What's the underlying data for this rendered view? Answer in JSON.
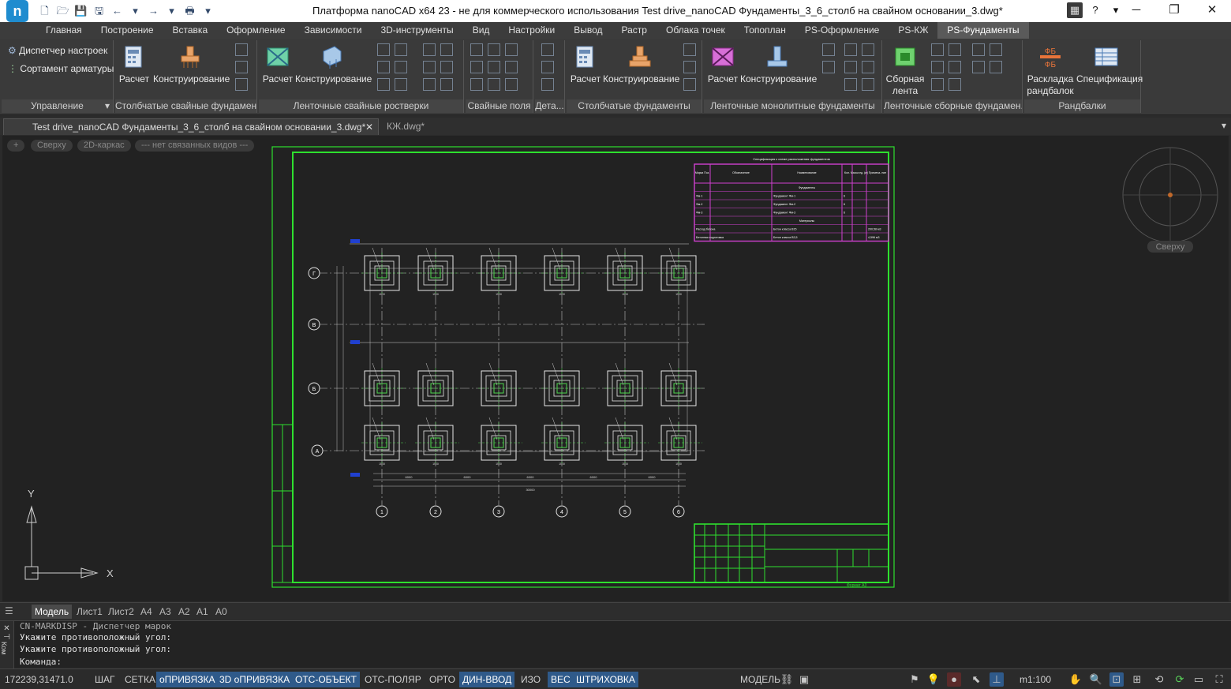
{
  "window": {
    "title": "Платформа nanoCAD x64 23 - не для коммерческого использования Test drive_nanoCAD Фундаменты_3_6_столб на свайном основании_3.dwg*",
    "min": "─",
    "max": "❐",
    "close": "✕",
    "help": "?",
    "help_arrow": "▾"
  },
  "qat": [
    "🗋",
    "🗁",
    "💾",
    "🖫",
    "←",
    "▾",
    "→",
    "▾",
    "🖶",
    "▾"
  ],
  "menu": [
    "Главная",
    "Построение",
    "Вставка",
    "Оформление",
    "Зависимости",
    "3D-инструменты",
    "Вид",
    "Настройки",
    "Вывод",
    "Растр",
    "Облака точек",
    "Топоплан",
    "PS-Оформление",
    "PS-КЖ",
    "PS-Фундаменты"
  ],
  "ribbon": {
    "manage": {
      "item1": "Диспетчер настроек",
      "item2": "Сортамент арматуры",
      "label": "Управление",
      "arrow": "▾"
    },
    "p1": {
      "b1": "Расчет",
      "b2": "Конструирование",
      "label": "Столбчатые свайные фундамент..."
    },
    "p2": {
      "b1": "Расчет",
      "b2": "Конструирование",
      "label": "Ленточные свайные ростверки"
    },
    "p3": {
      "label": "Свайные поля"
    },
    "p4": {
      "label": "Дета..."
    },
    "p5": {
      "b1": "Расчет",
      "b2": "Конструирование",
      "label": "Столбчатые фундаменты"
    },
    "p6": {
      "b1": "Расчет",
      "b2": "Конструирование",
      "label": "Ленточные монолитные фундаменты"
    },
    "p7": {
      "b1": "Сборная лента",
      "label": "Ленточные сборные фундамен..."
    },
    "p8": {
      "b1": "Раскладка рандбалок",
      "b2": "Спецификация",
      "label": "Рандбалки",
      "icon1": "ФБ"
    }
  },
  "doctabs": {
    "tab1": "Test drive_nanoCAD Фундаменты_3_6_столб на свайном основании_3.dwg*",
    "tab1_close": "✕",
    "tab2": "КЖ.dwg*",
    "menu": "▾"
  },
  "viewport": {
    "pill_plus": "+",
    "pill_view": "Сверху",
    "pill_style": "2D-каркас",
    "pill_named": "--- нет связанных видов ---",
    "viewcube_label": "Сверху",
    "ucs_x": "X",
    "ucs_y": "Y",
    "drawing": {
      "spec_title": "Спецификация к схеме расположения фундаментов",
      "spec_headers": [
        "Марка Поз.",
        "Обозначение",
        "Наименование",
        "Кол.",
        "Масса ед. (кг)",
        "Примеча- ние"
      ],
      "spec_rows": [
        [
          "",
          "",
          "Фундаменты",
          "",
          "",
          ""
        ],
        [
          "Фм-1",
          "",
          "Фундамент Фм-1",
          "6",
          "",
          ""
        ],
        [
          "Фм-2",
          "",
          "Фундамент Фм-2",
          "6",
          "",
          ""
        ],
        [
          "Фм-3",
          "",
          "Фундамент Фм-3",
          "6",
          "",
          ""
        ],
        [
          "",
          "",
          "Материалы",
          "",
          "",
          ""
        ],
        [
          "Расход бетона",
          "",
          "Бетон класса В15",
          "",
          "",
          "200,58 м3"
        ],
        [
          "Бетонная подготовка",
          "",
          "Бетон класса В3,5",
          "",
          "",
          "4,596 м3"
        ]
      ],
      "axes_rows": [
        "Г",
        "В",
        "Б",
        "А"
      ],
      "axes_cols": [
        "1",
        "2",
        "3",
        "4",
        "5",
        "6"
      ],
      "dims_col": [
        "6000",
        "6000",
        "6000",
        "6000",
        "6000"
      ],
      "dim_total": "30000",
      "dim_cell": "1500",
      "stamp_small": "Формат А3"
    }
  },
  "layouts": [
    "Модель",
    "Лист1",
    "Лист2",
    "А4",
    "А3",
    "А2",
    "А1",
    "А0"
  ],
  "command": {
    "lines": [
      "CN-MARKDISP - Диспетчер марок",
      "Укажите противоположный угол:",
      "Укажите противоположный угол:",
      "Команда:"
    ],
    "side_close": "✕",
    "side_pin": "⊣",
    "side_label": "Ком"
  },
  "status": {
    "coords": "172239,31471.0",
    "toggles": [
      "ШАГ",
      "СЕТКА",
      "оПРИВЯЗКА",
      "3D оПРИВЯЗКА",
      "ОТС-ОБЪЕКТ",
      "ОТС-ПОЛЯР",
      "ОРТО",
      "ДИН-ВВОД",
      "ИЗО",
      "ВЕС",
      "ШТРИХОВКА"
    ],
    "on": [
      false,
      false,
      true,
      true,
      true,
      false,
      false,
      true,
      false,
      true,
      true
    ],
    "space": "МОДЕЛЬ",
    "scale": "m1:100"
  }
}
